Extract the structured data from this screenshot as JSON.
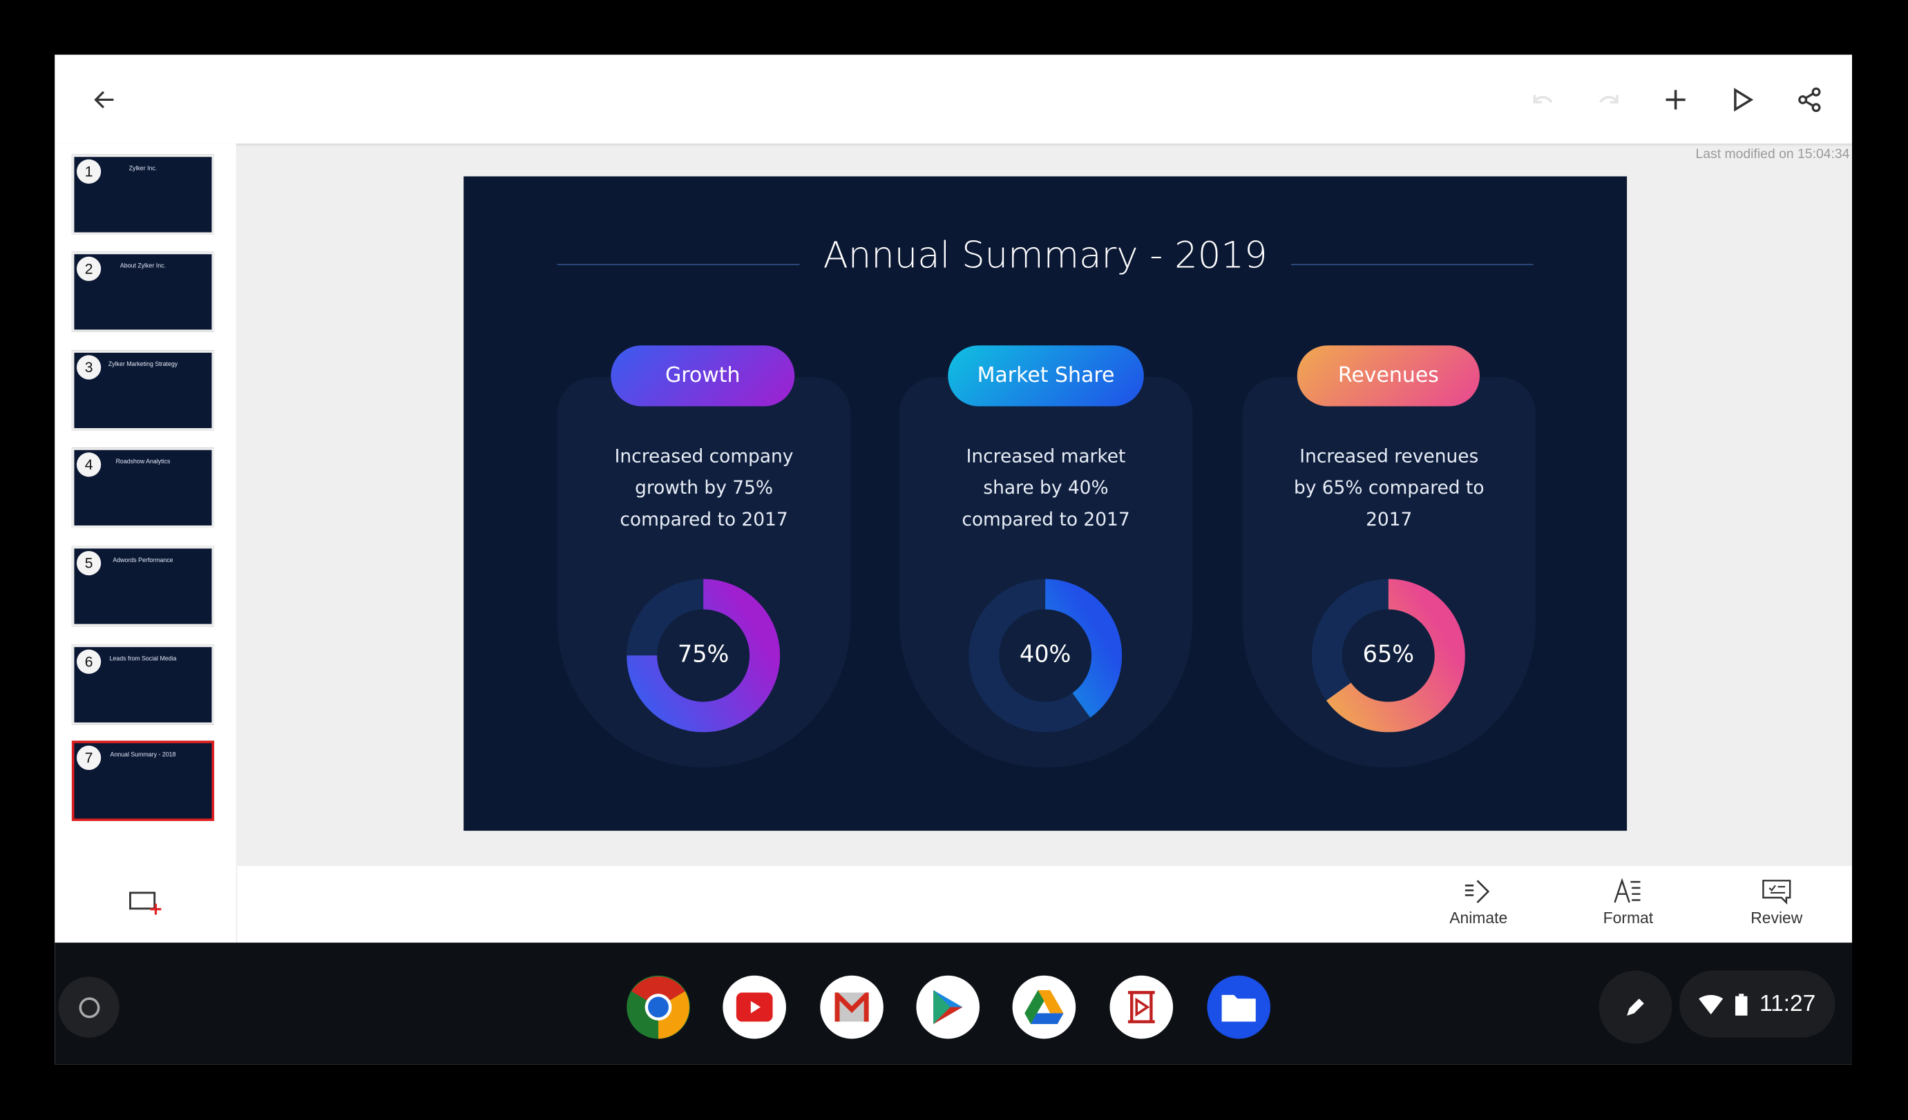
{
  "topbar": {
    "last_modified": "Last modified on 15:04:34",
    "icons": [
      "back-arrow-icon",
      "undo-icon",
      "redo-icon",
      "plus-icon",
      "play-icon",
      "share-icon"
    ]
  },
  "thumbnails": [
    {
      "number": "1",
      "title": "Zylker Inc."
    },
    {
      "number": "2",
      "title": "About Zylker Inc."
    },
    {
      "number": "3",
      "title": "Zylker Marketing Strategy"
    },
    {
      "number": "4",
      "title": "Roadshow Analytics"
    },
    {
      "number": "5",
      "title": "Adwords Performance"
    },
    {
      "number": "6",
      "title": "Leads from Social Media"
    },
    {
      "number": "7",
      "title": "Annual Summary - 2018",
      "selected": true
    }
  ],
  "slide": {
    "title": "Annual Summary - 2019",
    "cards": [
      {
        "label": "Growth",
        "lines": [
          "Increased company",
          "growth by 75%",
          "compared to 2017"
        ],
        "value_label": "75%",
        "percent": 75,
        "colors": [
          "#3a5cf0",
          "#a020d0"
        ]
      },
      {
        "label": "Market Share",
        "lines": [
          "Increased market",
          "share by 40%",
          "compared to 2017"
        ],
        "value_label": "40%",
        "percent": 40,
        "colors": [
          "#10c0e0",
          "#2050e8"
        ]
      },
      {
        "label": "Revenues",
        "lines": [
          "Increased revenues",
          "by 65% compared to",
          "2017"
        ],
        "value_label": "65%",
        "percent": 65,
        "colors": [
          "#f0a850",
          "#e84890"
        ]
      }
    ]
  },
  "bottombar": {
    "animate": "Animate",
    "format": "Format",
    "review": "Review"
  },
  "shelf": {
    "apps": [
      "chrome",
      "youtube",
      "gmail",
      "play-store",
      "drive",
      "zoho-show",
      "files"
    ],
    "time": "11:27"
  }
}
